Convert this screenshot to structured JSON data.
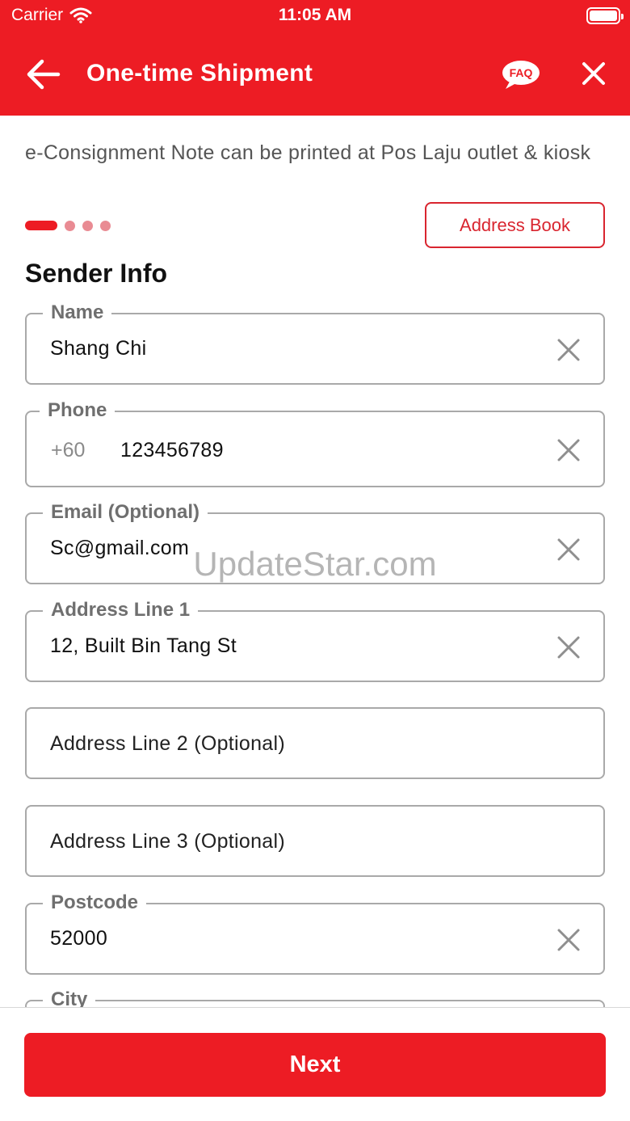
{
  "status_bar": {
    "carrier": "Carrier",
    "time": "11:05 AM"
  },
  "header": {
    "title": "One-time Shipment",
    "faq_label": "FAQ",
    "accent_color": "#ed1c24"
  },
  "notice": "e-Consignment Note can be printed at Pos Laju outlet & kiosk",
  "steps": {
    "total": 4,
    "current": 1
  },
  "address_book_label": "Address Book",
  "section_title": "Sender Info",
  "fields": {
    "name": {
      "label": "Name",
      "value": "Shang Chi"
    },
    "phone": {
      "label": "Phone",
      "country_code": "+60",
      "value": "123456789"
    },
    "email": {
      "label": "Email (Optional)",
      "value": "Sc@gmail.com"
    },
    "address1": {
      "label": "Address Line 1",
      "value": "12, Built Bin Tang St"
    },
    "address2": {
      "placeholder": "Address Line 2 (Optional)"
    },
    "address3": {
      "placeholder": "Address Line 3 (Optional)"
    },
    "postcode": {
      "label": "Postcode",
      "value": "52000"
    },
    "city": {
      "label": "City"
    }
  },
  "watermark": "UpdateStar.com",
  "next_label": "Next"
}
